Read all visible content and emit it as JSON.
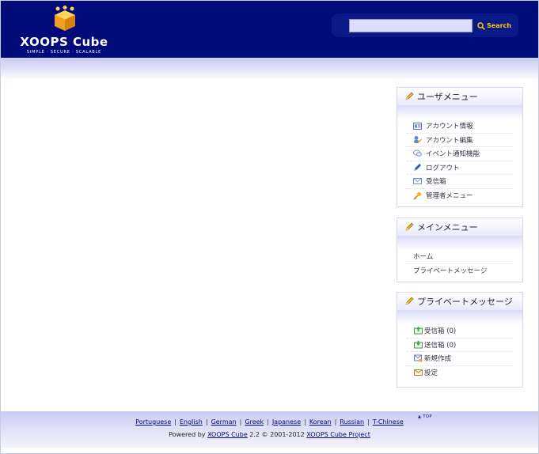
{
  "header": {
    "brand": "XOOPS Cube",
    "tagline": "SIMPLE · SECURE · SCALABLE",
    "search_button": "Search",
    "search_value": ""
  },
  "user_menu": {
    "title": "ユーザメニュー",
    "items": [
      {
        "label": "アカウント情報",
        "icon": "id-card-icon"
      },
      {
        "label": "アカウント編集",
        "icon": "edit-user-icon"
      },
      {
        "label": "イベント通知機能",
        "icon": "notification-icon"
      },
      {
        "label": "ログアウト",
        "icon": "logout-icon"
      },
      {
        "label": "受信箱",
        "icon": "mail-icon"
      },
      {
        "label": "管理者メニュー",
        "icon": "key-icon"
      }
    ]
  },
  "main_menu": {
    "title": "メインメニュー",
    "items": [
      {
        "label": "ホーム"
      },
      {
        "label": "プライベートメッセージ"
      }
    ]
  },
  "pm_menu": {
    "title": "プライベートメッセージ",
    "items": [
      {
        "label": "受信箱 (0)",
        "icon": "inbox-icon"
      },
      {
        "label": "送信箱 (0)",
        "icon": "outbox-icon"
      },
      {
        "label": "新規作成",
        "icon": "compose-icon"
      },
      {
        "label": "設定",
        "icon": "settings-icon"
      }
    ]
  },
  "footer": {
    "top_link": "▲ TOP",
    "languages": [
      "Portuguese",
      "English",
      "German",
      "Greek",
      "Japanese",
      "Korean",
      "Russian",
      "T-Chinese"
    ],
    "powered_prefix": "Powered by ",
    "powered_link": "XOOPS Cube",
    "powered_version": " 2.2 © 2001-2012 ",
    "project_link": "XOOPS Cube Project"
  },
  "colors": {
    "header_bg": "#000a78",
    "search_accent": "#ffcc00",
    "link": "#000a78"
  }
}
